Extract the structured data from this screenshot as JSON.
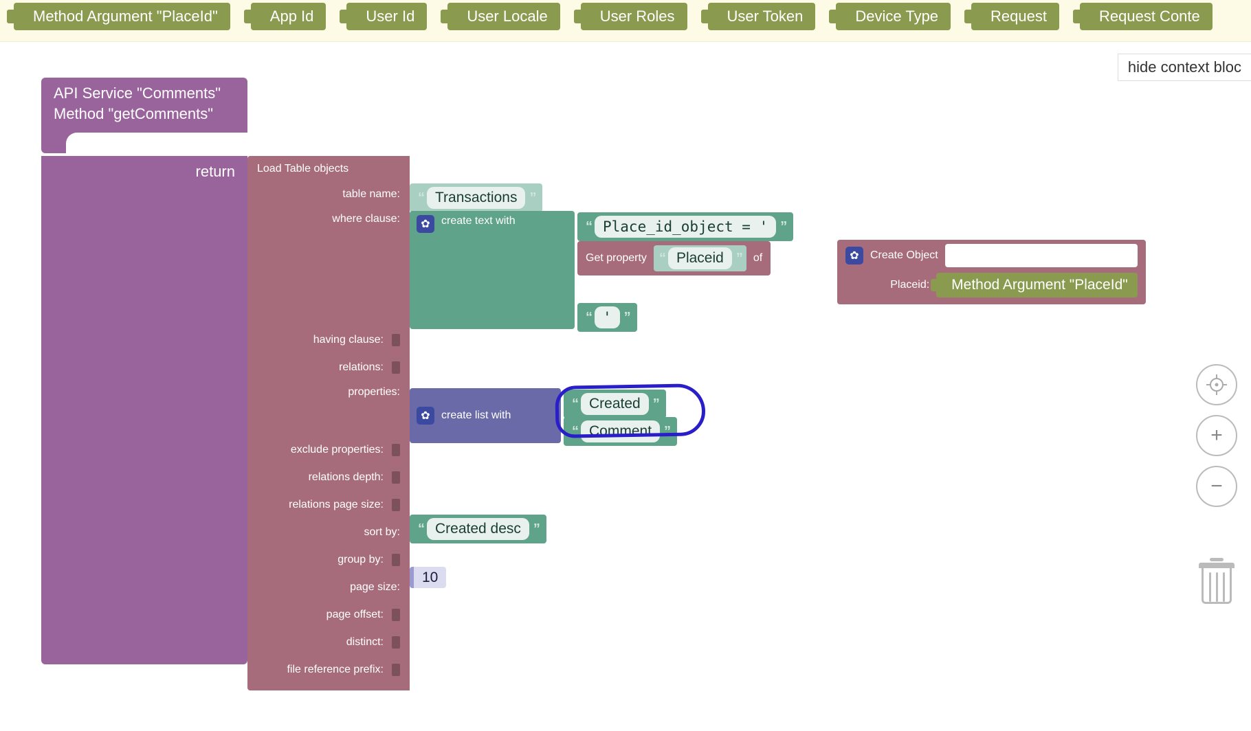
{
  "context_blocks": [
    "Method Argument \"PlaceId\"",
    "App Id",
    "User Id",
    "User Locale",
    "User Roles",
    "User Token",
    "Device Type",
    "Request",
    "Request Conte"
  ],
  "hide_link": "hide context bloc",
  "api": {
    "service_line": "API Service \"Comments\"",
    "method_line": "Method \"getComments\"",
    "return_label": "return"
  },
  "load_table": {
    "header": "Load Table objects",
    "fields": {
      "table_name": "table name:",
      "where_clause": "where clause:",
      "having_clause": "having clause:",
      "relations": "relations:",
      "properties": "properties:",
      "exclude_properties": "exclude properties:",
      "relations_depth": "relations depth:",
      "relations_page_size": "relations page size:",
      "sort_by": "sort by:",
      "group_by": "group by:",
      "page_size": "page size:",
      "page_offset": "page offset:",
      "distinct": "distinct:",
      "file_reference_prefix": "file reference prefix:"
    }
  },
  "values": {
    "table_name": "Transactions",
    "create_text_label": "create text with",
    "where_literal_1": "Place_id_object = '",
    "get_property_label": "Get property",
    "get_property_name": "Placeid",
    "of_label": "of",
    "create_object_label": "Create Object",
    "create_object_field": "Placeid:",
    "method_arg_inline": "Method Argument \"PlaceId\"",
    "where_literal_3": "'",
    "create_list_label": "create list with",
    "list_item_1": "Created",
    "list_item_2": "Comment",
    "sort_by": "Created desc",
    "page_size": "10"
  }
}
